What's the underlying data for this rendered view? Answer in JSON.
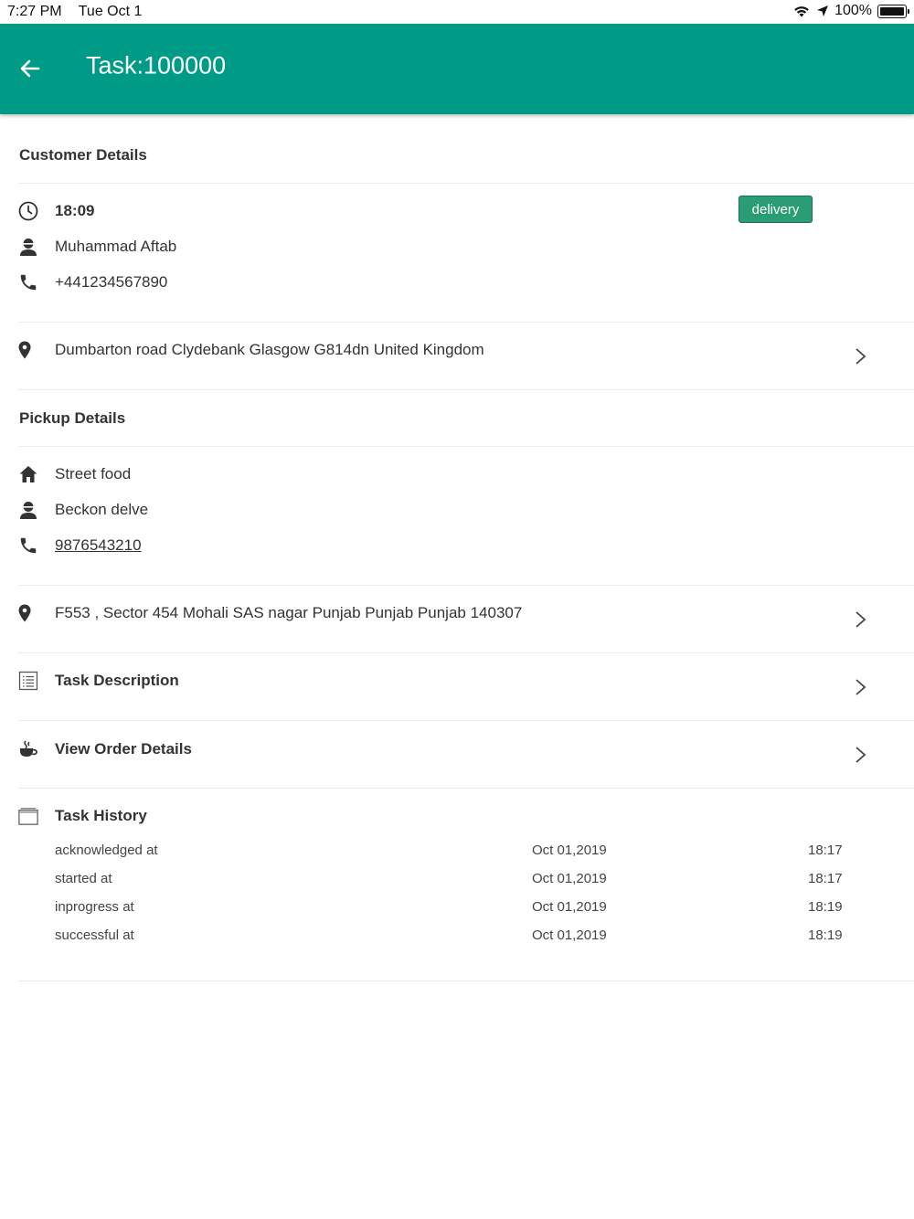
{
  "status_bar": {
    "time": "7:27 PM",
    "date": "Tue Oct 1",
    "battery": "100%"
  },
  "header": {
    "title": "Task:100000",
    "color": "#009b87"
  },
  "customer": {
    "section_title": "Customer Details",
    "time": "18:09",
    "badge": "delivery",
    "name": "Muhammad Aftab",
    "phone": "+441234567890",
    "address": "Dumbarton road Clydebank Glasgow G814dn United Kingdom"
  },
  "pickup": {
    "section_title": "Pickup Details",
    "place": "Street food",
    "name": "Beckon delve",
    "phone": "9876543210",
    "address": "F553 , Sector 454 Mohali SAS nagar Punjab Punjab Punjab 140307"
  },
  "task_description": {
    "label": "Task Description"
  },
  "order_details": {
    "label": "View Order Details"
  },
  "history": {
    "label": "Task History",
    "rows": [
      {
        "event": "acknowledged at",
        "date": "Oct 01,2019",
        "time": "18:17"
      },
      {
        "event": "started at",
        "date": "Oct 01,2019",
        "time": "18:17"
      },
      {
        "event": "inprogress at",
        "date": "Oct 01,2019",
        "time": "18:19"
      },
      {
        "event": "successful at",
        "date": "Oct 01,2019",
        "time": "18:19"
      }
    ]
  }
}
